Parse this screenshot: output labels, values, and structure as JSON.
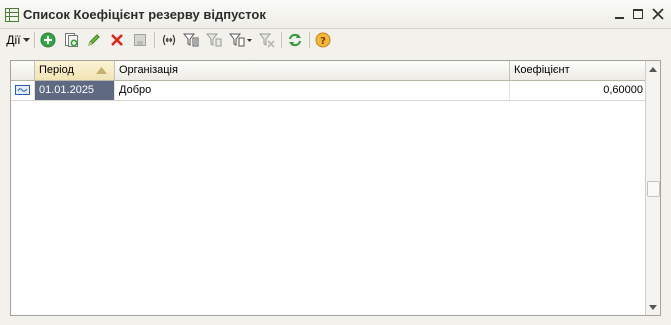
{
  "window": {
    "title": "Список Коефіцієнт резерву відпусток"
  },
  "toolbar": {
    "actions_label": "Дії",
    "buttons": [
      "add-icon",
      "copy-icon",
      "edit-icon",
      "delete-icon",
      "post-icon",
      "interval-icon",
      "filter-icon",
      "filter-by-value-icon",
      "filter-history-icon",
      "clear-filter-icon",
      "refresh-icon",
      "help-icon"
    ]
  },
  "table": {
    "columns": [
      "Період",
      "Організація",
      "Коефіцієнт"
    ],
    "rows": [
      {
        "period": "01.01.2025",
        "organization": "Добро",
        "coefficient": "0,60000"
      }
    ]
  },
  "colors": {
    "selection": "#5f6a82",
    "sorted_header": "#f1e3b4",
    "add_green": "#3aa34a",
    "delete_red": "#d9261c"
  }
}
